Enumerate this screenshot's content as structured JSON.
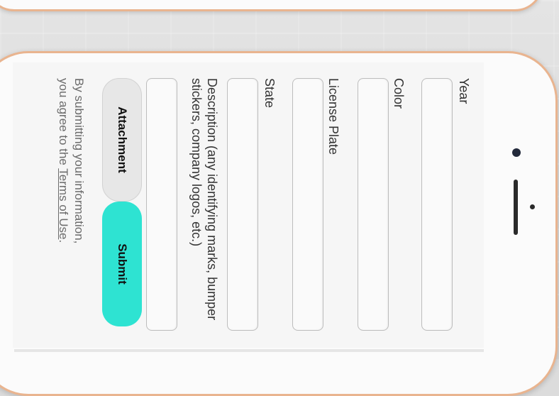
{
  "form": {
    "year_label": "Year",
    "color_label": "Color",
    "plate_label": "License Plate",
    "state_label": "State",
    "description_label": "Description (any identifying marks, bumper stickers, company logos, etc.)",
    "year_value": "",
    "color_value": "",
    "plate_value": "",
    "state_value": "",
    "description_value": ""
  },
  "buttons": {
    "attachment": "Attachment",
    "submit": "Submit"
  },
  "terms": {
    "line1": "By submitting your information,",
    "prefix": "you agree to the",
    "link": "Terms of Use",
    "suffix": "."
  },
  "colors": {
    "submit_accent": "#2ee3d2",
    "phone_trim": "#e9b48f"
  }
}
